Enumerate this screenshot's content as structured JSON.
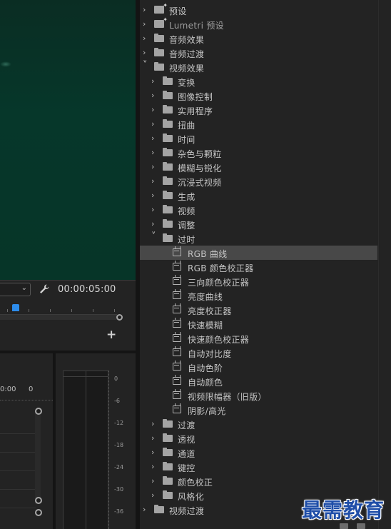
{
  "program_monitor": {
    "fit_dropdown_icon": "chevron-down-icon",
    "settings_icon": "wrench-icon",
    "timecode": "00:00:05:00",
    "add_icon": "+"
  },
  "timeline": {
    "time_left": "0:00",
    "time_right": "0"
  },
  "audio_meter": {
    "scale": [
      "0",
      "-6",
      "-12",
      "-18",
      "-24",
      "-30",
      "-36"
    ]
  },
  "effects_tree": [
    {
      "depth": 0,
      "type": "preset",
      "label": "预设",
      "expanded": false
    },
    {
      "depth": 0,
      "type": "preset",
      "label": "Lumetri 预设",
      "expanded": false
    },
    {
      "depth": 0,
      "type": "folder",
      "label": "音频效果",
      "expanded": false
    },
    {
      "depth": 0,
      "type": "folder",
      "label": "音频过渡",
      "expanded": false
    },
    {
      "depth": 0,
      "type": "folder",
      "label": "视频效果",
      "expanded": true
    },
    {
      "depth": 1,
      "type": "folder",
      "label": "变换",
      "expanded": false
    },
    {
      "depth": 1,
      "type": "folder",
      "label": "图像控制",
      "expanded": false
    },
    {
      "depth": 1,
      "type": "folder",
      "label": "实用程序",
      "expanded": false
    },
    {
      "depth": 1,
      "type": "folder",
      "label": "扭曲",
      "expanded": false
    },
    {
      "depth": 1,
      "type": "folder",
      "label": "时间",
      "expanded": false
    },
    {
      "depth": 1,
      "type": "folder",
      "label": "杂色与颗粒",
      "expanded": false
    },
    {
      "depth": 1,
      "type": "folder",
      "label": "模糊与锐化",
      "expanded": false
    },
    {
      "depth": 1,
      "type": "folder",
      "label": "沉浸式视频",
      "expanded": false
    },
    {
      "depth": 1,
      "type": "folder",
      "label": "生成",
      "expanded": false
    },
    {
      "depth": 1,
      "type": "folder",
      "label": "视频",
      "expanded": false
    },
    {
      "depth": 1,
      "type": "folder",
      "label": "调整",
      "expanded": false
    },
    {
      "depth": 1,
      "type": "folder",
      "label": "过时",
      "expanded": true
    },
    {
      "depth": 2,
      "type": "effect",
      "label": "RGB 曲线",
      "selected": true
    },
    {
      "depth": 2,
      "type": "effect",
      "label": "RGB 颜色校正器"
    },
    {
      "depth": 2,
      "type": "effect",
      "label": "三向颜色校正器"
    },
    {
      "depth": 2,
      "type": "effect",
      "label": "亮度曲线"
    },
    {
      "depth": 2,
      "type": "effect",
      "label": "亮度校正器"
    },
    {
      "depth": 2,
      "type": "effect",
      "label": "快速模糊"
    },
    {
      "depth": 2,
      "type": "effect",
      "label": "快速颜色校正器"
    },
    {
      "depth": 2,
      "type": "effect",
      "label": "自动对比度"
    },
    {
      "depth": 2,
      "type": "effect",
      "label": "自动色阶"
    },
    {
      "depth": 2,
      "type": "effect",
      "label": "自动颜色"
    },
    {
      "depth": 2,
      "type": "effect",
      "label": "视频限幅器（旧版）"
    },
    {
      "depth": 2,
      "type": "effect",
      "label": "阴影/高光"
    },
    {
      "depth": 1,
      "type": "folder",
      "label": "过渡",
      "expanded": false
    },
    {
      "depth": 1,
      "type": "folder",
      "label": "透视",
      "expanded": false
    },
    {
      "depth": 1,
      "type": "folder",
      "label": "通道",
      "expanded": false
    },
    {
      "depth": 1,
      "type": "folder",
      "label": "键控",
      "expanded": false
    },
    {
      "depth": 1,
      "type": "folder",
      "label": "颜色校正",
      "expanded": false
    },
    {
      "depth": 1,
      "type": "folder",
      "label": "风格化",
      "expanded": false
    },
    {
      "depth": 0,
      "type": "folder",
      "label": "视频过渡",
      "expanded": false
    }
  ],
  "watermark": "最需教育",
  "colors": {
    "panel_bg": "#232323",
    "selected_row": "#484848",
    "playhead": "#2d8ceb",
    "watermark": "#1f4ea8"
  }
}
